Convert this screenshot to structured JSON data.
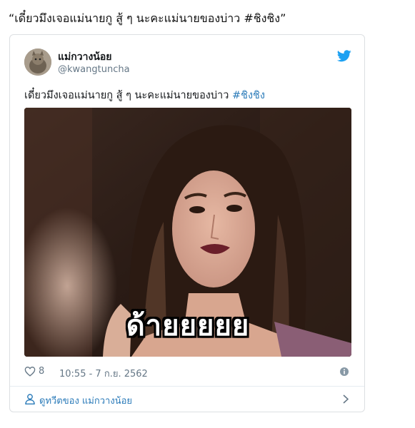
{
  "quote": "“เดี๋ยวมึงเจอแม่นายกู สู้ ๆ นะคะแม่นายของบ่าว #ชิงชิง”",
  "tweet": {
    "author_name": "แม่กวางน้อย",
    "author_handle": "@kwangtuncha",
    "text": "เดี๋ยวมึงเจอแม่นายกู สู้ ๆ นะคะแม่นายของบ่าว ",
    "hashtag": "#ชิงชิง",
    "media_caption": "ด้ายยยยย",
    "like_count": "8",
    "timestamp": "10:55 - 7 ก.ย. 2562",
    "view_more_label": "ดูทวีตของ แม่กวางน้อย"
  },
  "colors": {
    "link": "#2b7bb9",
    "twitter_blue": "#1da1f2",
    "muted": "#657786",
    "border": "#dcdfe2"
  },
  "icons": {
    "brand": "twitter-bird-icon",
    "like": "heart-icon",
    "info": "info-icon",
    "profile": "person-icon",
    "more": "chevron-right-icon"
  }
}
